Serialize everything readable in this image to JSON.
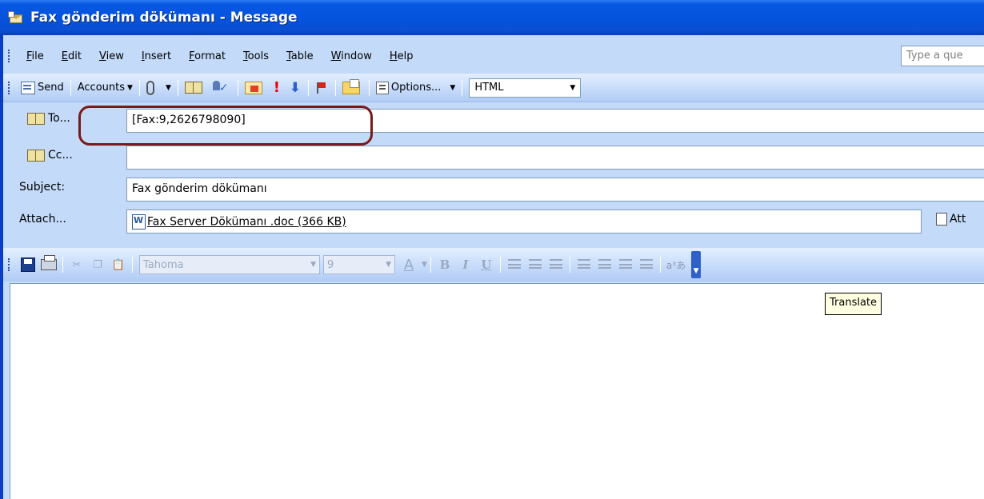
{
  "window": {
    "title": "Fax gönderim dökümanı - Message"
  },
  "menu": {
    "items": [
      "File",
      "Edit",
      "View",
      "Insert",
      "Format",
      "Tools",
      "Table",
      "Window",
      "Help"
    ],
    "question_placeholder": "Type a que"
  },
  "toolbar": {
    "send_label": "Send",
    "accounts_label": "Accounts",
    "options_label": "Options...",
    "format_value": "HTML"
  },
  "address": {
    "to_label": "To...",
    "to_value": "[Fax:9,2626798090]",
    "cc_label": "Cc...",
    "cc_value": "",
    "subject_label": "Subject:",
    "subject_value": "Fax gönderim dökümanı",
    "attach_label": "Attach...",
    "attach_value": "Fax Server Dökümanı .doc (366 KB)",
    "attach_options_label": "Att"
  },
  "format_toolbar": {
    "font_name": "Tahoma",
    "font_size": "9",
    "bold_label": "B",
    "italic_label": "I",
    "underline_label": "U",
    "translate_glyph": "a³あ"
  },
  "tooltip": {
    "text": "Translate"
  },
  "colors": {
    "titlebar": "#0453dd",
    "toolbar_bg": "#c3daf9",
    "highlight_ring": "#7a1a18"
  }
}
